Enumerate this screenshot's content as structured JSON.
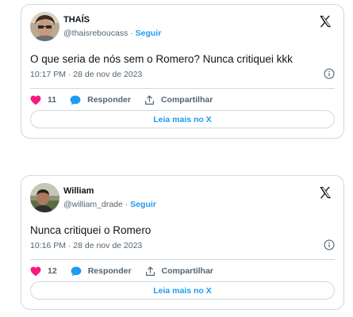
{
  "tweets": [
    {
      "name": "THAÍS",
      "handle": "@thaisreboucass",
      "separator": "·",
      "follow_label": "Seguir",
      "text": "O que seria de nós sem o Romero? Nunca critiquei kkk",
      "timestamp": "10:17 PM · 28 de nov de 2023",
      "likes": "11",
      "reply_label": "Responder",
      "share_label": "Compartilhar",
      "read_more_label": "Leia mais no X"
    },
    {
      "name": "William",
      "handle": "@william_drade",
      "separator": "·",
      "follow_label": "Seguir",
      "text": "Nunca critiquei o Romero",
      "timestamp": "10:16 PM · 28 de nov de 2023",
      "likes": "12",
      "reply_label": "Responder",
      "share_label": "Compartilhar",
      "read_more_label": "Leia mais no X"
    }
  ],
  "icons": {
    "platform": "x-logo-icon",
    "like": "heart-icon",
    "reply": "speech-bubble-icon",
    "share": "share-upload-icon",
    "info": "info-icon"
  },
  "colors": {
    "accent": "#1d9bf0",
    "like": "#f91880",
    "border": "#cfd9de",
    "secondary_text": "#536471"
  }
}
